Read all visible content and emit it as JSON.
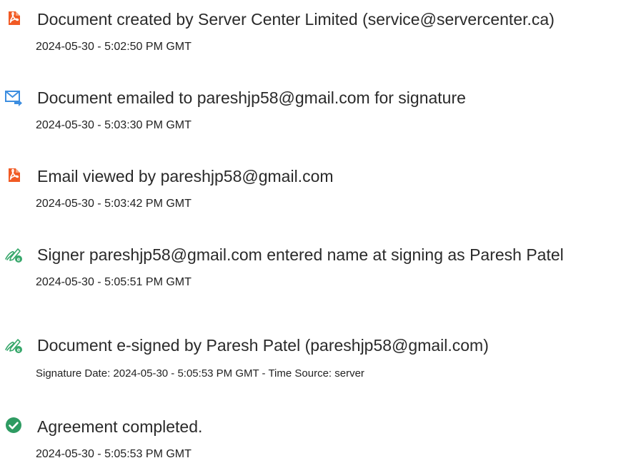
{
  "events": [
    {
      "icon": "document-pdf-icon",
      "title": "Document created by Server Center Limited (service@servercenter.ca)",
      "detail": "2024-05-30 - 5:02:50 PM GMT"
    },
    {
      "icon": "email-send-icon",
      "title": "Document emailed to pareshjp58@gmail.com for signature",
      "detail": "2024-05-30 - 5:03:30 PM GMT"
    },
    {
      "icon": "document-pdf-icon",
      "title": "Email viewed by pareshjp58@gmail.com",
      "detail": "2024-05-30 - 5:03:42 PM GMT"
    },
    {
      "icon": "signature-pen-icon",
      "title": "Signer pareshjp58@gmail.com entered name at signing as Paresh Patel",
      "detail": "2024-05-30 - 5:05:51 PM GMT"
    },
    {
      "icon": "signature-pen-icon",
      "title": "Document e-signed by Paresh Patel (pareshjp58@gmail.com)",
      "detail": "Signature Date: 2024-05-30 - 5:05:53 PM GMT - Time Source: server"
    },
    {
      "icon": "check-circle-icon",
      "title": "Agreement completed.",
      "detail": "2024-05-30 - 5:05:53 PM GMT"
    }
  ],
  "colors": {
    "pdf_icon": "#f15a24",
    "email_icon": "#3d8ee0",
    "sign_icon": "#37a76b",
    "check_icon": "#2e9b62"
  }
}
